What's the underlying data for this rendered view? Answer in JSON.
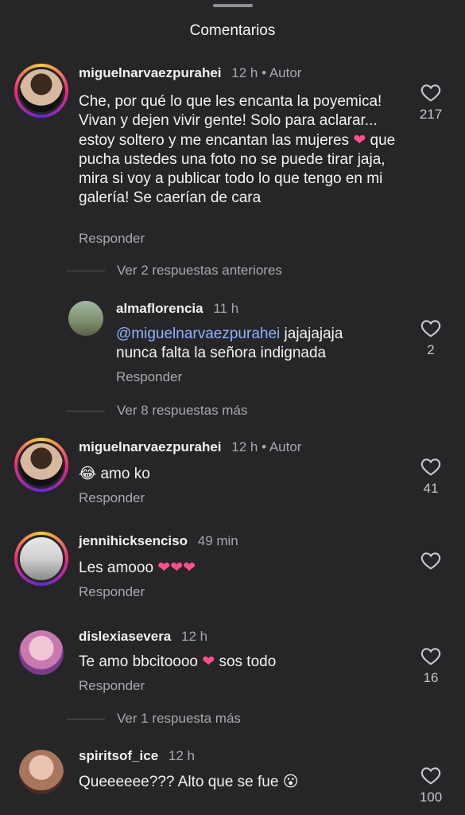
{
  "header": {
    "title": "Comentarios"
  },
  "comments": [
    {
      "user": "miguelnarvaezpurahei",
      "time": "12 h",
      "author": "• Autor",
      "text_parts": [
        "Che, por qué lo que les encanta la poyemica! Vivan y dejen vivir gente! Solo para aclarar... estoy soltero y me encantan las mujeres ",
        "❤",
        " que pucha ustedes una foto no se puede tirar jaja, mira si voy a publicar todo lo que tengo en mi galería! Se caerían de cara"
      ],
      "reply": "Responder",
      "likes": "217"
    },
    {
      "thread": "Ver 2 respuestas anteriores"
    },
    {
      "user": "almaflorencia",
      "time": "11 h",
      "mention": "@miguelnarvaezpurahei",
      "text": " jajajajaja nunca falta la señora indignada",
      "reply": "Responder",
      "likes": "2"
    },
    {
      "thread": "Ver 8 respuestas más"
    },
    {
      "user": "miguelnarvaezpurahei",
      "time": "12 h",
      "author": "• Autor",
      "emoji": "😂",
      "text": "amo ko",
      "reply": "Responder",
      "likes": "41"
    },
    {
      "user": "jennihicksenciso",
      "time": "49 min",
      "text": "Les amooo",
      "hearts": "❤❤❤",
      "reply": "Responder"
    },
    {
      "user": "dislexiasevera",
      "time": "12 h",
      "text_parts": [
        "Te amo bbcitoooo ",
        "❤",
        " sos todo"
      ],
      "reply": "Responder",
      "likes": "16"
    },
    {
      "thread": "Ver 1 respuesta más"
    },
    {
      "user": "spiritsof_ice",
      "time": "12 h",
      "text": "Queeeeee??? Alto que se fue ",
      "emoji": "😮",
      "likes": "100"
    }
  ],
  "colors": {
    "background": "#262628",
    "muted": "#a8a8ad",
    "mention": "#8fb2ff",
    "heart": "#ff4f8e"
  },
  "icons": [
    "heart-outline-icon",
    "avatar-ring"
  ]
}
